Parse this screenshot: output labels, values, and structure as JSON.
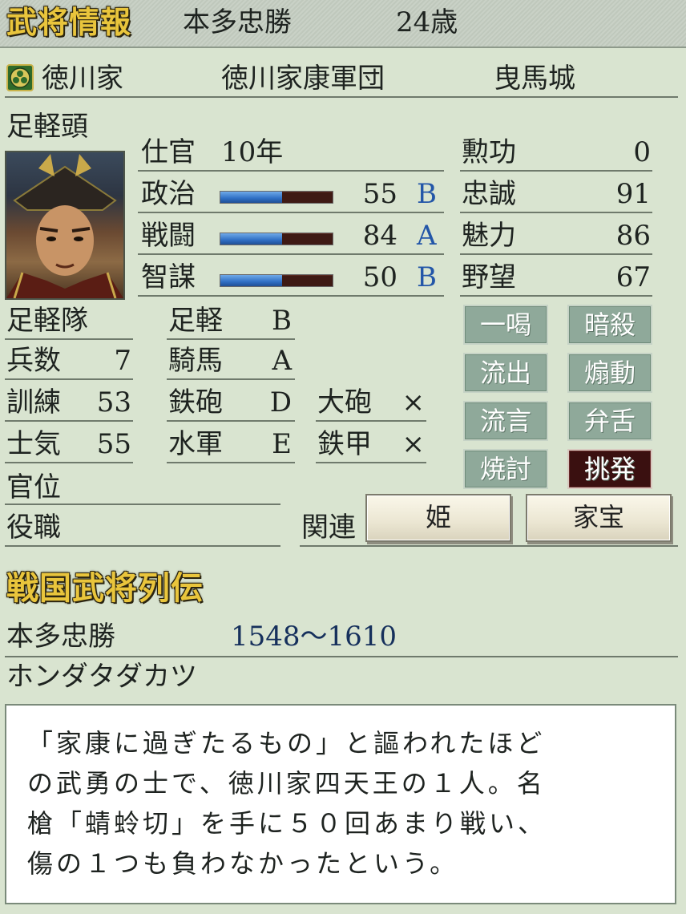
{
  "header": {
    "title": "武将情報",
    "name": "本多忠勝",
    "age": "24歳"
  },
  "affiliation": {
    "clan": "徳川家",
    "corps": "徳川家康軍団",
    "castle": "曳馬城"
  },
  "rank": "足軽頭",
  "service": {
    "label": "仕官",
    "value": "10年"
  },
  "abilities": [
    {
      "label": "政治",
      "value": "55",
      "grade": "B",
      "fill": 0.55
    },
    {
      "label": "戦闘",
      "value": "84",
      "grade": "A",
      "fill": 0.55
    },
    {
      "label": "智謀",
      "value": "50",
      "grade": "B",
      "fill": 0.55
    }
  ],
  "traits": [
    {
      "label": "勲功",
      "value": "0"
    },
    {
      "label": "忠誠",
      "value": "91"
    },
    {
      "label": "魅力",
      "value": "86"
    },
    {
      "label": "野望",
      "value": "67"
    }
  ],
  "unit": {
    "type": "足軽隊",
    "stats": [
      {
        "label": "兵数",
        "value": "7"
      },
      {
        "label": "訓練",
        "value": "53"
      },
      {
        "label": "士気",
        "value": "55"
      }
    ]
  },
  "aptitudes": [
    {
      "label": "足軽",
      "value": "B"
    },
    {
      "label": "騎馬",
      "value": "A"
    },
    {
      "label": "鉄砲",
      "value": "D"
    },
    {
      "label": "水軍",
      "value": "E"
    }
  ],
  "equipment": [
    {
      "label": "大砲",
      "value": "×"
    },
    {
      "label": "鉄甲",
      "value": "×"
    }
  ],
  "commands": [
    {
      "label": "一喝",
      "active": false
    },
    {
      "label": "暗殺",
      "active": false
    },
    {
      "label": "流出",
      "active": false
    },
    {
      "label": "煽動",
      "active": false
    },
    {
      "label": "流言",
      "active": false
    },
    {
      "label": "弁舌",
      "active": false
    },
    {
      "label": "焼討",
      "active": false
    },
    {
      "label": "挑発",
      "active": true
    }
  ],
  "court_rank_label": "官位",
  "role_label": "役職",
  "relations": {
    "label": "関連",
    "buttons": [
      "姫",
      "家宝"
    ]
  },
  "biography": {
    "title": "戦国武将列伝",
    "name": "本多忠勝",
    "years": "1548～1610",
    "reading": "ホンダタダカツ",
    "lines": [
      "「家康に過ぎたるもの」と謳われたほど",
      "の武勇の士で、徳川家四天王の１人。名",
      "槍「蜻蛉切」を手に５０回あまり戦い、",
      "傷の１つも負わなかったという。"
    ]
  },
  "colors": {
    "background": "#d9e4d0",
    "gold_title": "#e9c53c",
    "grade_blue": "#2356a8",
    "command_button": "#8fa99a",
    "command_active": "#3a1010",
    "bar_fill": "#2f6fc4",
    "bar_track": "#3e1a14"
  },
  "icons": {
    "clan_crest": "tokugawa-crest-icon",
    "portrait": "general-portrait"
  }
}
